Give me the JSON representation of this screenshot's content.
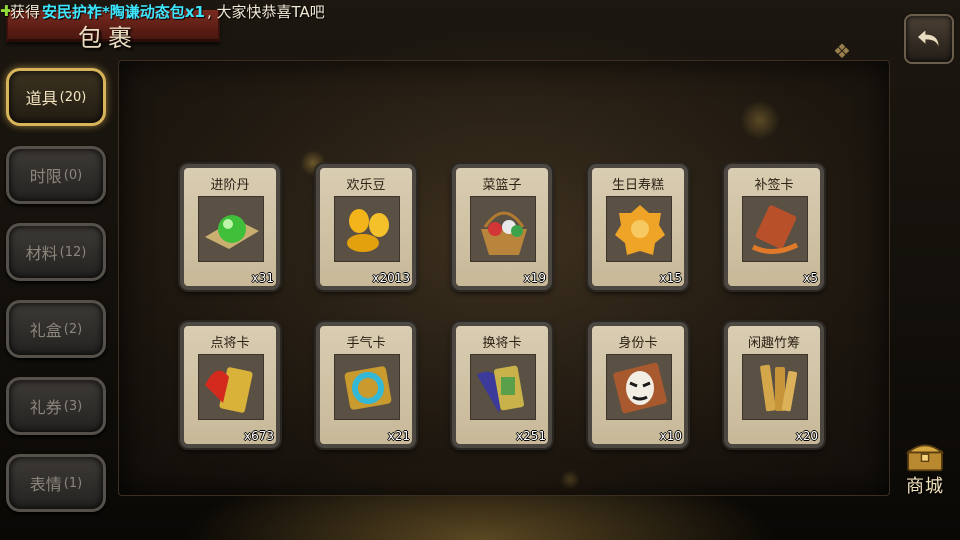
{
  "broadcast": {
    "prefix": "获得",
    "item": "安民护祚*陶谦动态包x1",
    "suffix": ", 大家快恭喜TA吧"
  },
  "page": {
    "title": "包裹"
  },
  "tabs": [
    {
      "label": "道具",
      "count": "(20)",
      "active": true
    },
    {
      "label": "时限",
      "count": "(0)",
      "active": false
    },
    {
      "label": "材料",
      "count": "(12)",
      "active": false
    },
    {
      "label": "礼盒",
      "count": "(2)",
      "active": false
    },
    {
      "label": "礼券",
      "count": "(3)",
      "active": false
    },
    {
      "label": "表情",
      "count": "(1)",
      "active": false
    }
  ],
  "items": [
    {
      "name": "进阶丹",
      "qty": "x31",
      "icon": "green-pill-icon"
    },
    {
      "name": "欢乐豆",
      "qty": "x2013",
      "icon": "gold-beans-icon"
    },
    {
      "name": "菜篮子",
      "qty": "x19",
      "icon": "vegetable-basket-icon"
    },
    {
      "name": "生日寿糕",
      "qty": "x15",
      "icon": "birthday-cake-icon"
    },
    {
      "name": "补签卡",
      "qty": "x5",
      "icon": "sign-in-card-icon"
    },
    {
      "name": "点将卡",
      "qty": "x673",
      "icon": "general-card-icon"
    },
    {
      "name": "手气卡",
      "qty": "x21",
      "icon": "luck-card-icon"
    },
    {
      "name": "换将卡",
      "qty": "x251",
      "icon": "swap-general-card-icon"
    },
    {
      "name": "身份卡",
      "qty": "x10",
      "icon": "identity-mask-icon"
    },
    {
      "name": "闲趣竹筹",
      "qty": "x20",
      "icon": "bamboo-tally-icon"
    }
  ],
  "shop": {
    "label": "商城",
    "icon": "treasure-chest-icon"
  },
  "back": {
    "icon": "back-arrow-icon"
  },
  "colors": {
    "active_tab_border": "#d8b55a",
    "broadcast_item": "#3ee7ff",
    "title_banner": "#7a2a1f"
  }
}
